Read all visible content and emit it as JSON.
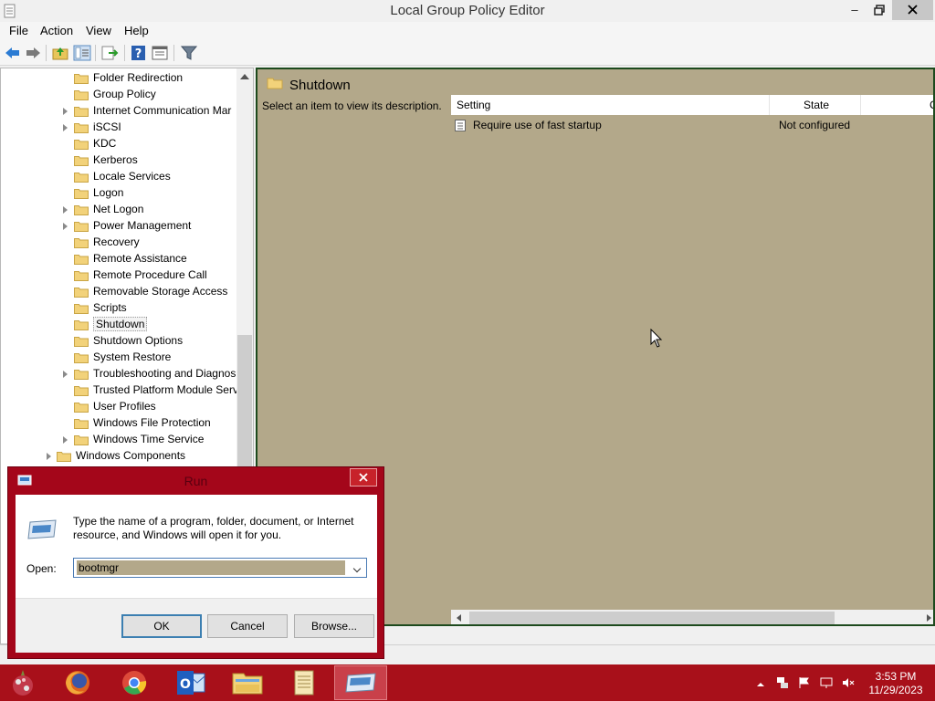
{
  "window": {
    "title": "Local Group Policy Editor"
  },
  "menu": [
    "File",
    "Action",
    "View",
    "Help"
  ],
  "toolbar_icons": [
    "back-icon",
    "forward-icon",
    "up-folder-icon",
    "show-hide-tree-icon",
    "export-list-icon",
    "help-icon",
    "properties-icon",
    "filter-icon"
  ],
  "tree": {
    "items": [
      {
        "label": "Folder Redirection",
        "expandable": false
      },
      {
        "label": "Group Policy",
        "expandable": false
      },
      {
        "label": "Internet Communication Mar",
        "expandable": true
      },
      {
        "label": "iSCSI",
        "expandable": true
      },
      {
        "label": "KDC",
        "expandable": false
      },
      {
        "label": "Kerberos",
        "expandable": false
      },
      {
        "label": "Locale Services",
        "expandable": false
      },
      {
        "label": "Logon",
        "expandable": false
      },
      {
        "label": "Net Logon",
        "expandable": true
      },
      {
        "label": "Power Management",
        "expandable": true
      },
      {
        "label": "Recovery",
        "expandable": false
      },
      {
        "label": "Remote Assistance",
        "expandable": false
      },
      {
        "label": "Remote Procedure Call",
        "expandable": false
      },
      {
        "label": "Removable Storage Access",
        "expandable": false
      },
      {
        "label": "Scripts",
        "expandable": false
      },
      {
        "label": "Shutdown",
        "expandable": false,
        "selected": true
      },
      {
        "label": "Shutdown Options",
        "expandable": false
      },
      {
        "label": "System Restore",
        "expandable": false
      },
      {
        "label": "Troubleshooting and Diagnos",
        "expandable": true
      },
      {
        "label": "Trusted Platform Module Serv",
        "expandable": false
      },
      {
        "label": "User Profiles",
        "expandable": false
      },
      {
        "label": "Windows File Protection",
        "expandable": false
      },
      {
        "label": "Windows Time Service",
        "expandable": true
      }
    ],
    "parent_item": {
      "label": "Windows Components",
      "expandable": true
    }
  },
  "content": {
    "folder_title": "Shutdown",
    "description": "Select an item to view its description.",
    "columns": {
      "setting": "Setting",
      "state": "State",
      "comment": "C"
    },
    "rows": [
      {
        "setting": "Require use of fast startup",
        "state": "Not configured"
      }
    ]
  },
  "run_dialog": {
    "title": "Run",
    "message": "Type the name of a program, folder, document, or Internet resource, and Windows will open it for you.",
    "open_label": "Open:",
    "open_value": "bootmgr",
    "ok_label": "OK",
    "cancel_label": "Cancel",
    "browse_label": "Browse..."
  },
  "taskbar": {
    "apps": [
      "firefox-icon",
      "chrome-icon",
      "outlook-icon",
      "file-explorer-icon",
      "notepad-icon",
      "run-icon"
    ],
    "time": "3:53 PM",
    "date": "11/29/2023"
  },
  "colors": {
    "content_bg": "#b3a88a",
    "taskbar": "#a8101a",
    "dialog_frame": "#a4061a"
  }
}
